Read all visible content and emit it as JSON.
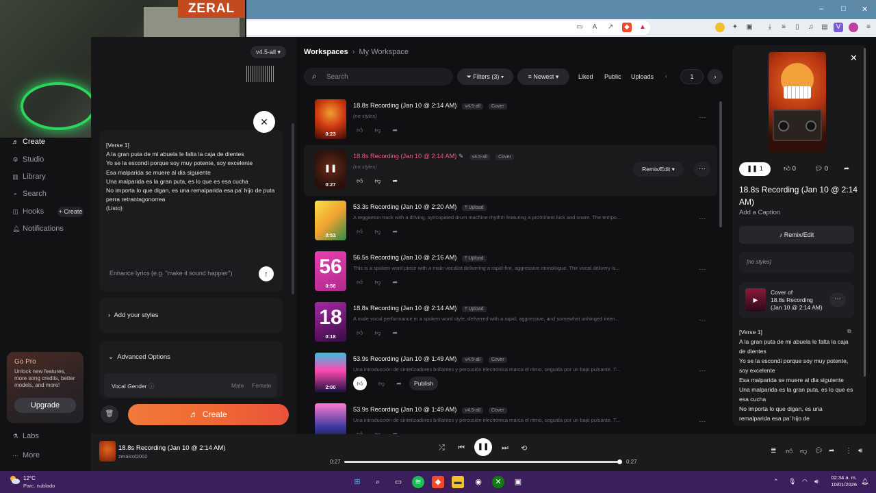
{
  "webcam": {
    "overlay_text": "ZERAL"
  },
  "browser": {
    "window_controls": {
      "minimize": "–",
      "maximize": "□",
      "close": "✕"
    }
  },
  "sidebar": {
    "items": [
      {
        "label": "Create",
        "icon": "music-note-icon"
      },
      {
        "label": "Studio",
        "icon": "studio-icon"
      },
      {
        "label": "Library",
        "icon": "library-icon"
      },
      {
        "label": "Search",
        "icon": "search-icon"
      },
      {
        "label": "Hooks",
        "icon": "hooks-icon"
      },
      {
        "label": "Notifications",
        "icon": "bell-icon"
      }
    ],
    "hooks_create": "+ Create",
    "gopro": {
      "title": "Go Pro",
      "body": "Unlock new features, more song credits, better models, and more!",
      "button": "Upgrade"
    },
    "labs": "Labs",
    "more": "More"
  },
  "create_panel": {
    "version": "v4.5-all",
    "lyrics": "[Verse 1]\nA la gran puta de mi abuela le falta la caja de dientes\nYo se la escondi porque soy muy potente, soy excelente\nEsa malparida se muere al dia siguiente\nUna malparida es la gran puta, es lo que es esa cucha\nNo importa lo que digan, es una remalparida esa pa' hijo de puta perra retrantagonorrea\n(Listo)",
    "enhance_placeholder": "Enhance lyrics (e.g. \"make it sound happier\")",
    "add_styles": "Add your styles",
    "advanced_options": "Advanced Options",
    "vocal_gender": "Vocal Gender",
    "gender_options": [
      "Male",
      "Female"
    ],
    "create_button": "Create"
  },
  "workspace": {
    "breadcrumb": {
      "root": "Workspaces",
      "current": "My Workspace"
    },
    "search_placeholder": "Search",
    "filters": "Filters (3)",
    "sort": "Newest",
    "chips": [
      "Liked",
      "Public",
      "Uploads"
    ],
    "page": "1",
    "songs": [
      {
        "title": "18.8s Recording (Jan 10 @ 2:14 AM)",
        "tags": [
          "v4.5-all",
          "Cover"
        ],
        "desc": "(no styles)",
        "duration": "0:23",
        "thumb": "orange"
      },
      {
        "title": "18.8s Recording (Jan 10 @ 2:14 AM)",
        "tags": [
          "v4.5-all",
          "Cover"
        ],
        "desc": "(no styles)",
        "duration": "0:27",
        "thumb": "dark",
        "playing": true
      },
      {
        "title": "53.3s Recording (Jan 10 @ 2:20 AM)",
        "tags": [
          "Upload"
        ],
        "desc": "A reggaeton track with a driving, syncopated drum machine rhythm featuring a prominent kick and snare. The tempo...",
        "duration": "0:53",
        "thumb": "yellow"
      },
      {
        "title": "56.5s Recording (Jan 10 @ 2:16 AM)",
        "tags": [
          "Upload"
        ],
        "desc": "This is a spoken word piece with a male vocalist delivering a rapid-fire, aggressive monologue. The vocal delivery is...",
        "duration": "0:56",
        "thumb": "magenta",
        "big": "56"
      },
      {
        "title": "18.8s Recording (Jan 10 @ 2:14 AM)",
        "tags": [
          "Upload"
        ],
        "desc": "A male vocal performance in a spoken word style, delivered with a rapid, aggressive, and somewhat unhinged inten...",
        "duration": "0:18",
        "thumb": "purple",
        "big": "18"
      },
      {
        "title": "53.9s Recording (Jan 10 @ 1:49 AM)",
        "tags": [
          "v4.5-all",
          "Cover"
        ],
        "desc": "Una introducción de sintetizadores brillantes y percusión electrónica marca el ritmo, seguida por un bajo pulsante. T...",
        "duration": "2:00",
        "thumb": "neon"
      },
      {
        "title": "53.9s Recording (Jan 10 @ 1:49 AM)",
        "tags": [
          "v4.5-all",
          "Cover"
        ],
        "desc": "Una introducción de sintetizadores brillantes y percusión electrónica marca el ritmo, seguida por un bajo pulsante. T...",
        "duration": "",
        "thumb": "neon2"
      }
    ],
    "remix_edit": "Remix/Edit",
    "publish": "Publish"
  },
  "detail": {
    "play_count": "1",
    "likes": "0",
    "comments": "0",
    "title": "18.8s Recording (Jan 10 @ 2:14 AM)",
    "caption": "Add a Caption",
    "remix_edit": "Remix/Edit",
    "no_styles": "[no styles]",
    "cover_of": {
      "label": "Cover of",
      "title": "18.8s Recording (Jan 10 @ 2:14 AM)"
    },
    "lyrics": "[Verse 1]\nA la gran puta de mi abuela le falta la caja de dientes\nYo se la escondi porque soy muy potente, soy excelente\nEsa malparida se muere al dia siguiente\nUna malparida es la gran puta, es lo que es esa cucha\nNo importa lo que digan, es una remalparida esa pa' hijo de"
  },
  "player": {
    "title": "18.8s Recording (Jan 10 @ 2:14 AM)",
    "user": "zeralcol2002",
    "elapsed": "0:27",
    "total": "0:27",
    "progress": 1.0
  },
  "taskbar": {
    "temperature": "12°C",
    "weather": "Parc. nublado",
    "time": "02:34 a. m.",
    "date": "10/01/2026"
  },
  "colors": {
    "accent": "#f06a33",
    "pink_title": "#f25a8d",
    "taskbar": "#3a1f5c"
  }
}
